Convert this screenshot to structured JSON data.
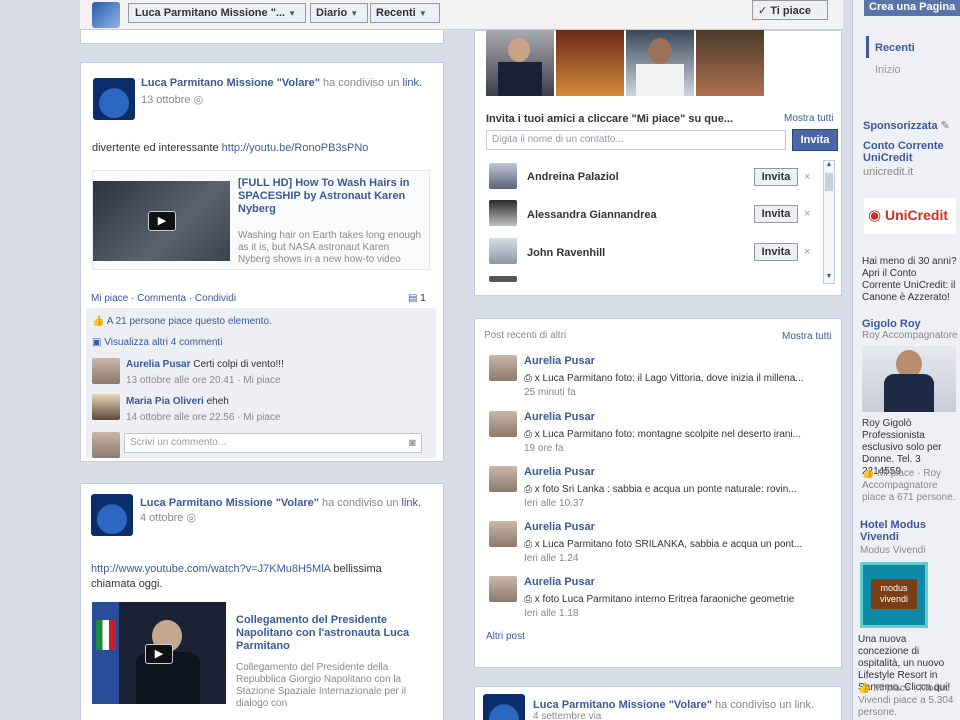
{
  "topbar": {
    "page_name": "Luca Parmitano Missione \"...",
    "diario": "Diario",
    "recenti": "Recenti",
    "ti_piace": "✓ Ti piace"
  },
  "right": {
    "crea_pagina": "Crea una Pagina",
    "recenti": "Recenti",
    "inizio": "Inizio",
    "sponsorizzata": "Sponsorizzata",
    "ad1_title": "Conto Corrente UniCredit",
    "ad1_site": "unicredit.it",
    "ad1_logo": "UniCredit",
    "ad1_text": "Hai meno di 30 anni? Apri il Conto Corrente UniCredit: il Canone è Azzerato!",
    "ad2_title": "Gigolo Roy",
    "ad2_sub": "Roy Accompagnatore",
    "ad2_text": "Roy Gigolò Professionista esclusivo solo per Donne. Tel. 3 2214559",
    "ad2_like": "Mi piace · Roy Accompagnatore piace a 671 persone.",
    "ad3_title": "Hotel Modus Vivendi",
    "ad3_sub": "Modus Vivendi",
    "ad3_logo": "modus vivendi",
    "ad3_text": "Una nuova concezione di ospitalità, un nuovo Lifestyle Resort in Sanremo. Clicca qui!",
    "ad3_like": "Mi piace · Modus Vivendi piace a 5.304 persone."
  },
  "post1": {
    "author": "Luca Parmitano Missione \"Volare\"",
    "action": "ha condiviso un",
    "link_word": "link.",
    "date": "13 ottobre",
    "text": "divertente ed interessante",
    "url": "http://youtu.be/RonoPB3sPNo",
    "video_title": "[FULL HD] How To Wash Hairs in SPACESHIP by Astronaut Karen Nyberg",
    "video_desc": "Washing hair on Earth takes long enough as it is, but NASA astronaut Karen Nyberg shows in a new how-to video",
    "actions": "Mi piace · Commenta · Condividi",
    "comment_count": "1",
    "likes": "A 21 persone piace questo elemento.",
    "view_more": "Visualizza altri 4 commenti",
    "c1_name": "Aurelia Pusar",
    "c1_text": "Certi colpi di vento!!!",
    "c1_meta": "13 ottobre alle ore 20.41 · Mi piace",
    "c2_name": "Maria Pia Oliveri",
    "c2_text": "eheh",
    "c2_meta": "14 ottobre alle ore 22.56 · Mi piace",
    "comment_placeholder": "Scrivi un commento..."
  },
  "post2": {
    "author": "Luca Parmitano Missione \"Volare\"",
    "action": "ha condiviso un",
    "link_word": "link.",
    "date": "4 ottobre",
    "url": "http://www.youtube.com/watch?v=J7KMu8H5MlA",
    "text": " bellissima chiamata oggi.",
    "video_title": "Collegamento del Presidente Napolitano con l'astronauta Luca Parmitano",
    "video_desc": "Collegamento del Presidente della Repubblica Giorgio Napolitano con la Stazione Spaziale Internazionale per il dialogo con"
  },
  "invite": {
    "title": "Invita i tuoi amici a cliccare \"Mi piace\" su que...",
    "show_all": "Mostra tutti",
    "placeholder": "Digita il nome di un contatto...",
    "invite_btn": "Invita",
    "friends": [
      {
        "name": "Andreina Palaziol",
        "btn": "Invita"
      },
      {
        "name": "Alessandra Giannandrea",
        "btn": "Invita"
      },
      {
        "name": "John Ravenhill",
        "btn": "Invita"
      }
    ]
  },
  "recent_posts": {
    "title": "Post recenti di altri",
    "show_all": "Mostra tutti",
    "items": [
      {
        "name": "Aurelia Pusar",
        "text": "x Luca Parmitano foto: il Lago Vittoria, dove inizia il millena...",
        "time": "25 minuti fa"
      },
      {
        "name": "Aurelia Pusar",
        "text": "x Luca Parmitano foto: montagne scolpite nel deserto irani...",
        "time": "19 ore fa"
      },
      {
        "name": "Aurelia Pusar",
        "text": "x foto Sri Lanka : sabbia e acqua un ponte naturale: rovin...",
        "time": "Ieri alle 10.37"
      },
      {
        "name": "Aurelia Pusar",
        "text": "x Luca Parmitano foto SRILANKA, sabbia e acqua un pont...",
        "time": "Ieri alle 1.24"
      },
      {
        "name": "Aurelia Pusar",
        "text": "x foto Luca Parmitano interno Eritrea faraoniche geometrie",
        "time": "Ieri alle 1.18"
      }
    ],
    "more": "Altri post"
  },
  "post3": {
    "author": "Luca Parmitano Missione \"Volare\"",
    "action": "ha condiviso un link.",
    "date": "4 settembre via"
  }
}
